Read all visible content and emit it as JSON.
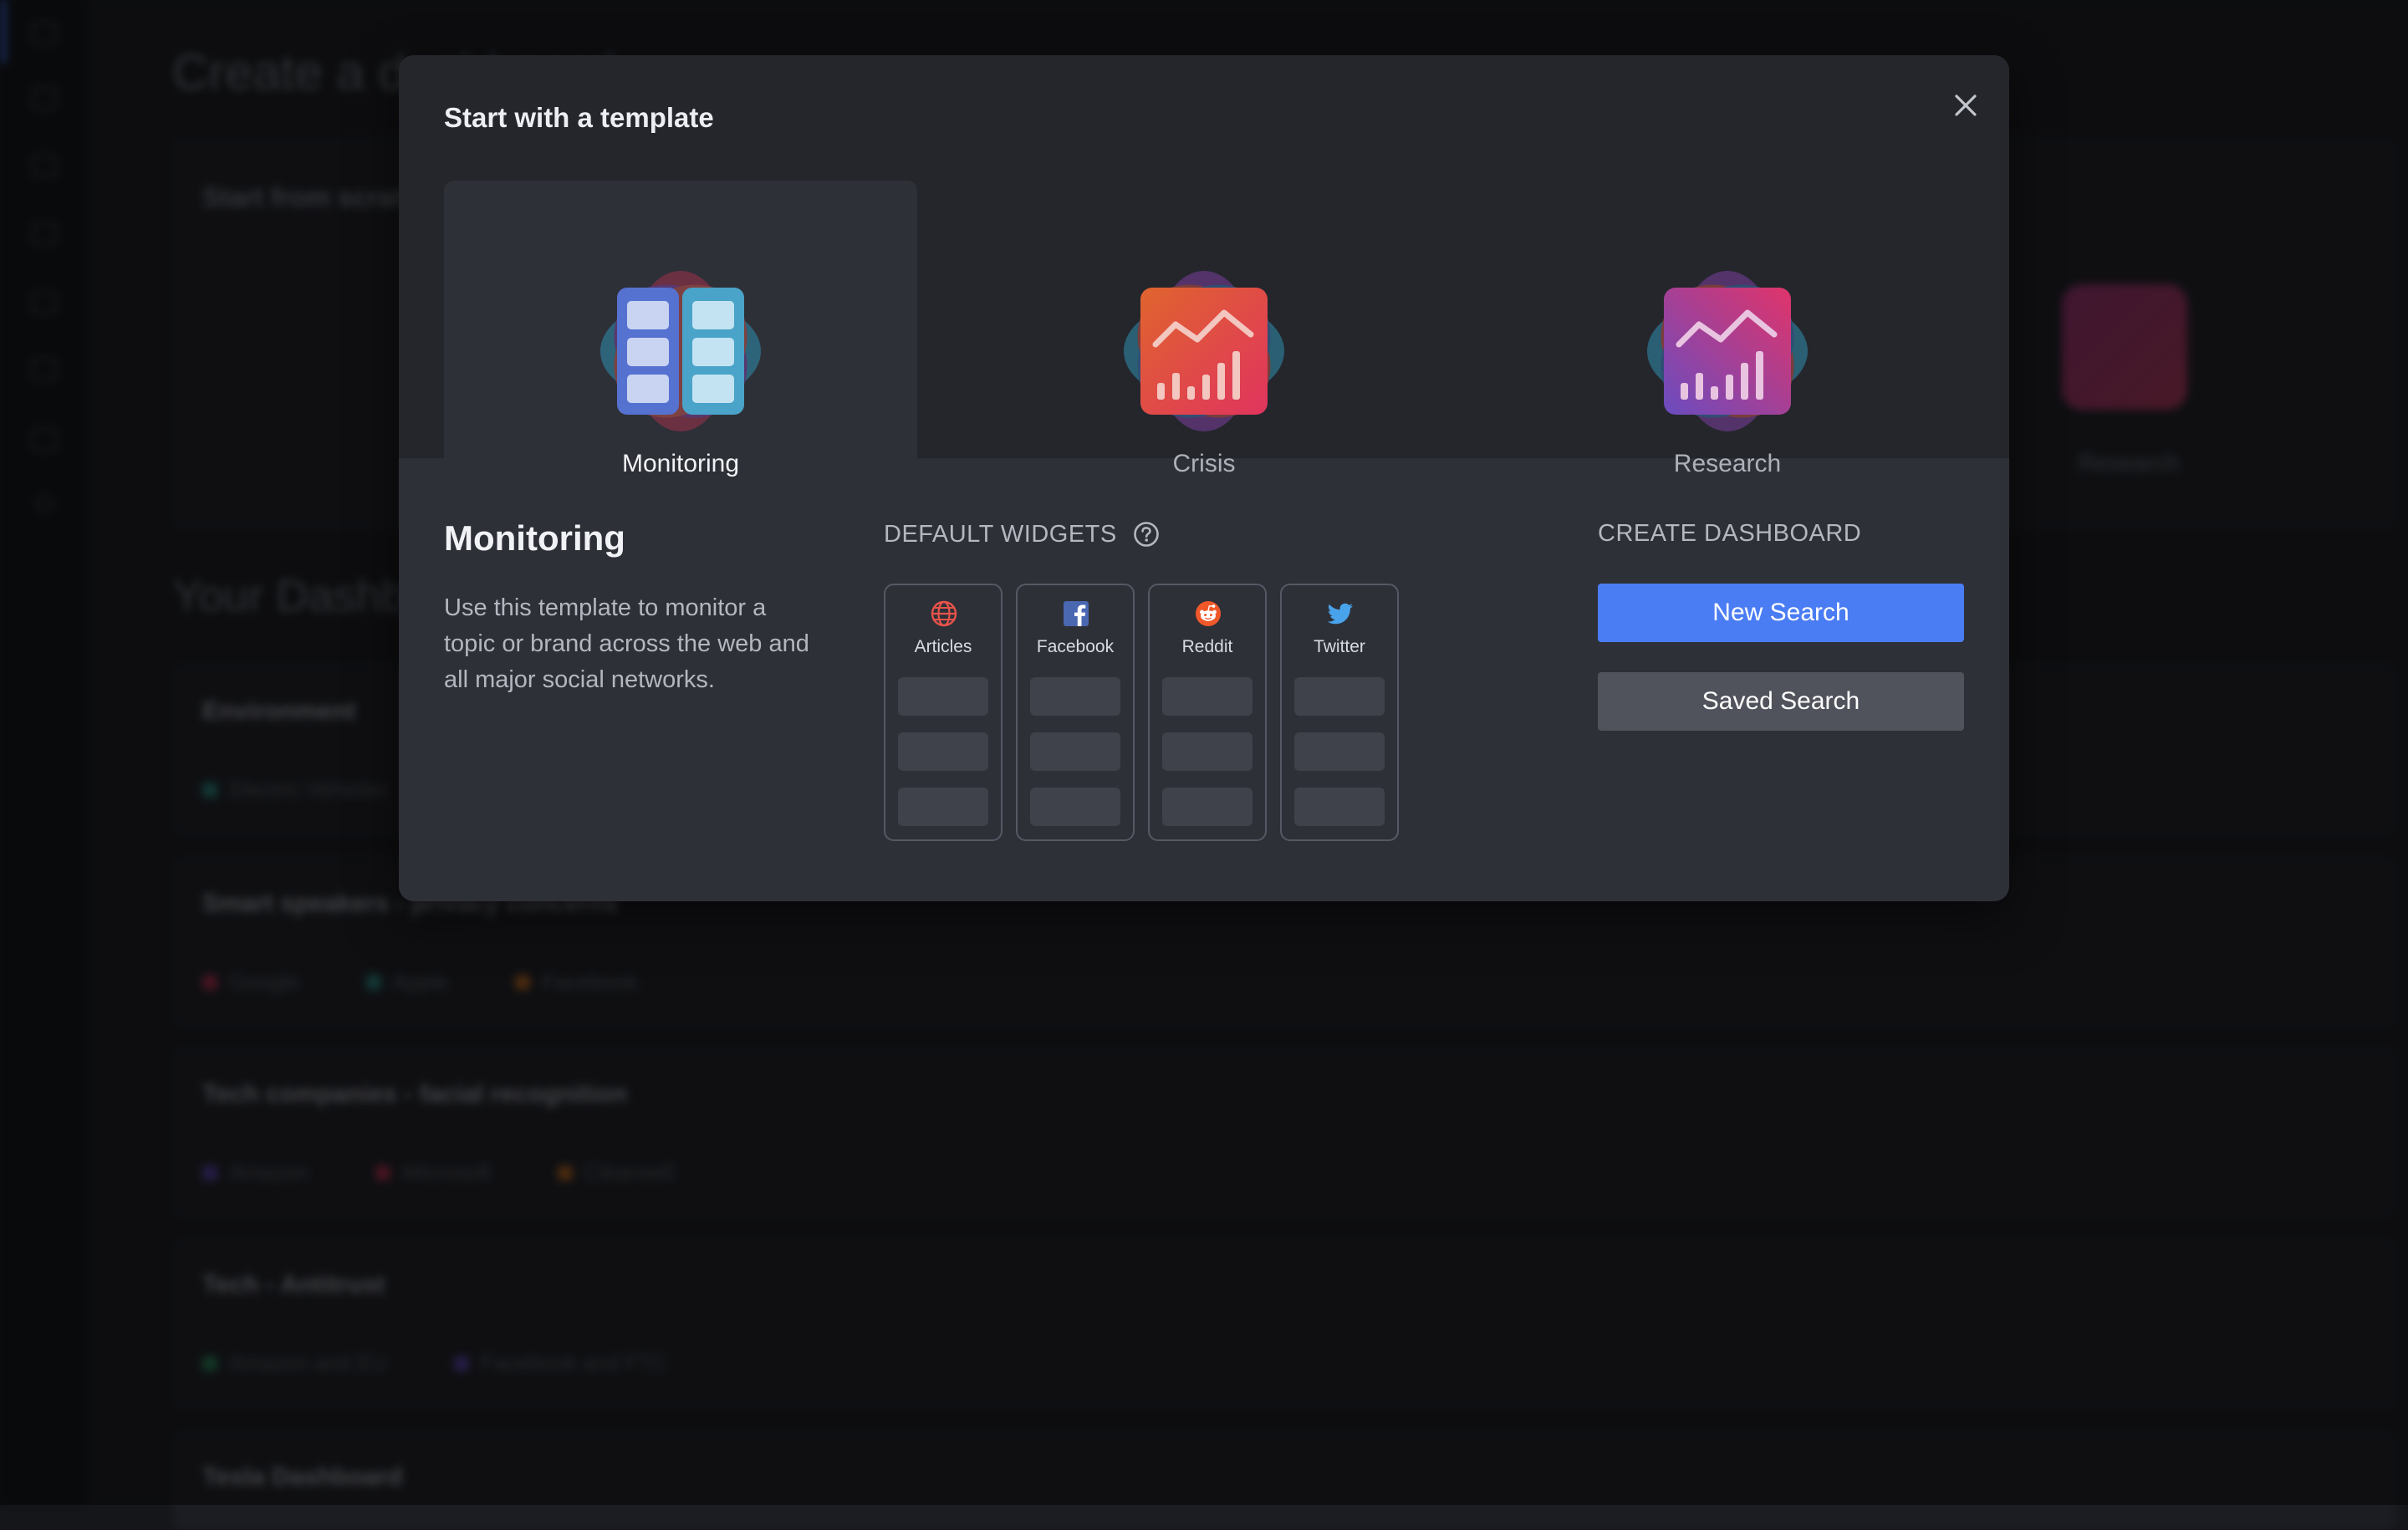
{
  "background": {
    "page_title": "Create a dashboard",
    "start_from_scratch": "Start from scratch",
    "research_label": "Research",
    "section_title": "Your Dashboards",
    "cards": [
      {
        "title": "Environment",
        "chips": [
          {
            "label": "Electric Vehicles",
            "color": "#2fa39a"
          }
        ]
      },
      {
        "title": "Smart speakers - privacy concerns",
        "chips": [
          {
            "label": "Google",
            "color": "#d8345a"
          },
          {
            "label": "Apple",
            "color": "#2fa39a"
          },
          {
            "label": "Facebook",
            "color": "#e07a1f"
          }
        ]
      },
      {
        "title": "Tech companies - facial recognition",
        "chips": [
          {
            "label": "Amazon",
            "color": "#6c4ed0"
          },
          {
            "label": "Microsoft",
            "color": "#d8345a"
          },
          {
            "label": "Clearwell",
            "color": "#e07a1f"
          }
        ]
      },
      {
        "title": "Tech - Antitrust",
        "chips": [
          {
            "label": "Amazon and EU",
            "color": "#2fa36a"
          },
          {
            "label": "Facebook and FTC",
            "color": "#6c4ed0"
          }
        ]
      },
      {
        "title": "Tesla Dashboard",
        "chips": []
      }
    ]
  },
  "modal": {
    "title": "Start with a template",
    "close_icon": "close-icon",
    "templates": [
      {
        "label": "Monitoring",
        "icon": "monitoring-grid-icon",
        "selected": true
      },
      {
        "label": "Crisis",
        "icon": "crisis-chart-icon",
        "selected": false
      },
      {
        "label": "Research",
        "icon": "research-chart-icon",
        "selected": false
      }
    ],
    "description": {
      "title": "Monitoring",
      "text": "Use this template to monitor a topic or brand across the web and all major social networks."
    },
    "default_widgets": {
      "label": "DEFAULT WIDGETS",
      "help_icon": "help-icon",
      "items": [
        {
          "label": "Articles",
          "icon": "globe-icon",
          "color": "#e8534a"
        },
        {
          "label": "Facebook",
          "icon": "facebook-icon",
          "color": "#4a67b2"
        },
        {
          "label": "Reddit",
          "icon": "reddit-icon",
          "color": "#f0582a"
        },
        {
          "label": "Twitter",
          "icon": "twitter-icon",
          "color": "#49a3ea"
        }
      ]
    },
    "create": {
      "label": "CREATE DASHBOARD",
      "new_search": "New Search",
      "saved_search": "Saved Search"
    }
  },
  "colors": {
    "accent": "#4a7cf3",
    "modal_bg": "#2e3038",
    "secondary_button": "#50535c"
  }
}
